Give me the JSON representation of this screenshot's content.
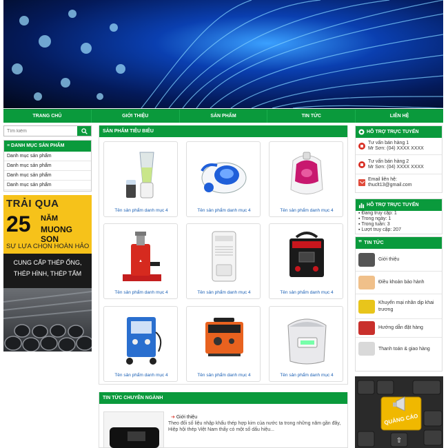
{
  "nav": [
    "Trang chủ",
    "Giới thiệu",
    "Sản phẩm",
    "Tin tức",
    "Liên hệ"
  ],
  "search": {
    "placeholder": "Tìm kiếm"
  },
  "categories": {
    "title": "Danh mục sản phẩm",
    "items": [
      "Danh mục sản phẩm",
      "Danh mục sản phẩm",
      "Danh mục sản phẩm",
      "Danh mục sản phẩm"
    ]
  },
  "ad_left": {
    "line1": "TRẢI QUA",
    "number": "25",
    "years": "NĂM",
    "brand": "MUONG SON",
    "tagline": "SỰ LỰA CHỌN HOÀN HẢO",
    "offer1": "CUNG CẤP THÉP ỐNG,",
    "offer2": "THÉP HÌNH, THÉP TẤM"
  },
  "products": {
    "title": "Sản phẩm tiêu biểu",
    "items": [
      {
        "name": "Tên sản phẩm danh mục 4",
        "icon": "blender-icon"
      },
      {
        "name": "Tên sản phẩm danh mục 4",
        "icon": "vacuum-icon"
      },
      {
        "name": "Tên sản phẩm danh mục 4",
        "icon": "vacuum-pink-icon"
      },
      {
        "name": "Tên sản phẩm danh mục 4",
        "icon": "hydraulic-jack-icon"
      },
      {
        "name": "Tên sản phẩm danh mục 4",
        "icon": "dehumidifier-icon"
      },
      {
        "name": "Tên sản phẩm danh mục 4",
        "icon": "welder-icon"
      },
      {
        "name": "Tên sản phẩm danh mục 4",
        "icon": "welder-blue-icon"
      },
      {
        "name": "Tên sản phẩm danh mục 4",
        "icon": "welder-orange-icon"
      },
      {
        "name": "Tên sản phẩm danh mục 4",
        "icon": "rice-cooker-icon"
      }
    ]
  },
  "industry_news": {
    "title": "Tin tức chuyên ngành",
    "item_title": "Giới thiệu",
    "item_desc": "Theo đối số liệu nhập khẩu thép hợp kim của nước ta trong những năm gần đây, Hiệp hội thép Việt Nam thấy có một số dấu hiệu..."
  },
  "support": {
    "title": "Hỗ trợ trực tuyến",
    "items": [
      {
        "line1": "Tư vấn bán hàng 1",
        "line2": "Mr Sơn: (04) XXXX XXXX"
      },
      {
        "line1": "Tư vấn bán hàng 2",
        "line2": "Mr Sơn: (04) XXXX XXXX"
      },
      {
        "line1": "Email liên hệ:",
        "line2": "thuclt13@gmail.com"
      }
    ]
  },
  "stats": {
    "title": "Hỗ trợ trực tuyến",
    "lines": [
      "Đang truy cập: 1",
      "Trong ngày: 1",
      "Trong tuần: 3",
      "Lượt truy cập: 207"
    ]
  },
  "news": {
    "title": "Tin tức",
    "items": [
      "Giới thiệu",
      "Điều khoản bảo hành",
      "Khuyến mại nhân dịp khai trương",
      "Hướng dẫn đặt hàng",
      "Thanh toán & giao hàng"
    ]
  },
  "ad_right": {
    "label": "QUẢNG CÁO"
  },
  "colors": {
    "brand_green": "#0a9a3c",
    "link_blue": "#1a5fb4"
  }
}
